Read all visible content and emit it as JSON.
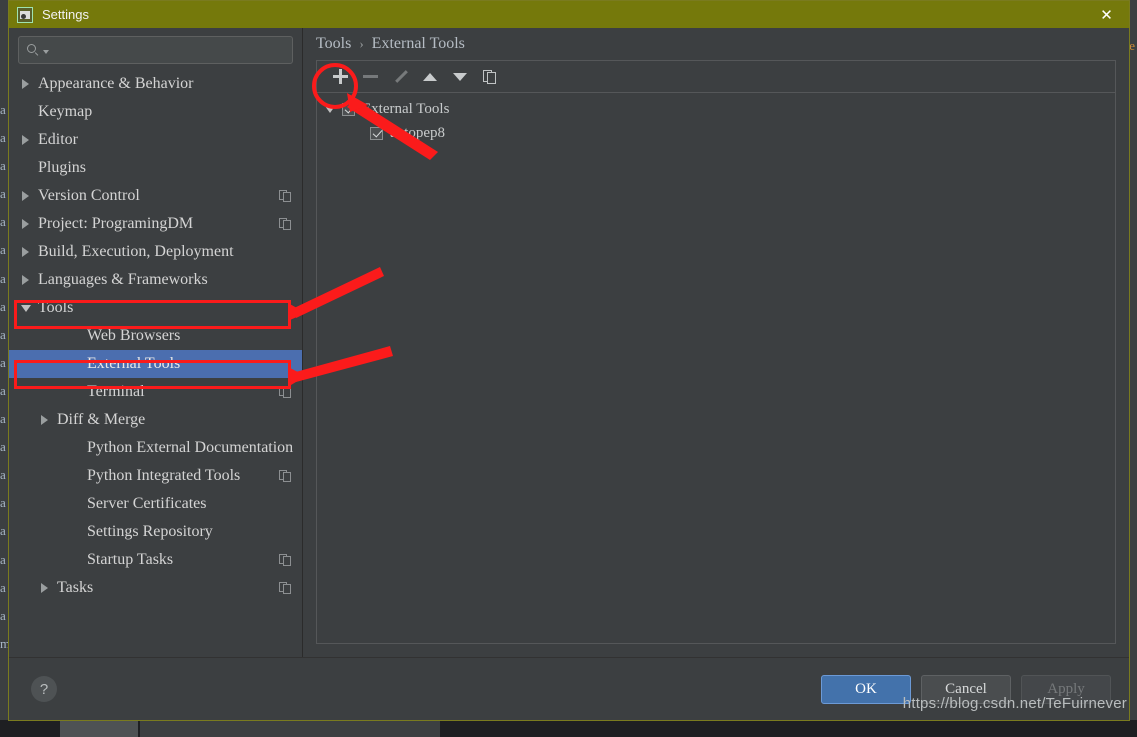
{
  "window": {
    "title": "Settings",
    "app_icon": "settings-image-icon",
    "close_icon": "close-icon"
  },
  "search": {
    "value": "",
    "placeholder": "",
    "icon": "search-icon",
    "caret_icon": "chevron-down-icon"
  },
  "sidebar": {
    "items": [
      {
        "label": "Appearance & Behavior",
        "arrow": "right",
        "level": 1,
        "badge": false,
        "selected": false
      },
      {
        "label": "Keymap",
        "arrow": "none",
        "level": 1,
        "badge": false,
        "selected": false
      },
      {
        "label": "Editor",
        "arrow": "right",
        "level": 1,
        "badge": false,
        "selected": false
      },
      {
        "label": "Plugins",
        "arrow": "none",
        "level": 1,
        "badge": false,
        "selected": false
      },
      {
        "label": "Version Control",
        "arrow": "right",
        "level": 1,
        "badge": true,
        "selected": false
      },
      {
        "label": "Project: ProgramingDM",
        "arrow": "right",
        "level": 1,
        "badge": true,
        "selected": false
      },
      {
        "label": "Build, Execution, Deployment",
        "arrow": "right",
        "level": 1,
        "badge": false,
        "selected": false
      },
      {
        "label": "Languages & Frameworks",
        "arrow": "right",
        "level": 1,
        "badge": false,
        "selected": false
      },
      {
        "label": "Tools",
        "arrow": "down",
        "level": 1,
        "badge": false,
        "selected": false
      },
      {
        "label": "Web Browsers",
        "arrow": "none",
        "level": 2,
        "badge": false,
        "selected": false
      },
      {
        "label": "External Tools",
        "arrow": "none",
        "level": 2,
        "badge": false,
        "selected": true
      },
      {
        "label": "Terminal",
        "arrow": "none",
        "level": 2,
        "badge": true,
        "selected": false
      },
      {
        "label": "Diff & Merge",
        "arrow": "right",
        "level": 2,
        "badge": false,
        "selected": false
      },
      {
        "label": "Python External Documentation",
        "arrow": "none",
        "level": 2,
        "badge": false,
        "selected": false
      },
      {
        "label": "Python Integrated Tools",
        "arrow": "none",
        "level": 2,
        "badge": true,
        "selected": false
      },
      {
        "label": "Server Certificates",
        "arrow": "none",
        "level": 2,
        "badge": false,
        "selected": false
      },
      {
        "label": "Settings Repository",
        "arrow": "none",
        "level": 2,
        "badge": false,
        "selected": false
      },
      {
        "label": "Startup Tasks",
        "arrow": "none",
        "level": 2,
        "badge": true,
        "selected": false
      },
      {
        "label": "Tasks",
        "arrow": "right",
        "level": 2,
        "badge": true,
        "selected": false
      }
    ]
  },
  "content": {
    "breadcrumb": {
      "parent": "Tools",
      "separator": "›",
      "current": "External Tools"
    },
    "toolbar": [
      {
        "name": "add-button",
        "icon": "plus-icon",
        "enabled": true
      },
      {
        "name": "remove-button",
        "icon": "minus-icon",
        "enabled": false
      },
      {
        "name": "edit-button",
        "icon": "pencil-icon",
        "enabled": false
      },
      {
        "name": "move-up-button",
        "icon": "arrow-up-icon",
        "enabled": true
      },
      {
        "name": "move-down-button",
        "icon": "arrow-down-icon",
        "enabled": true
      },
      {
        "name": "copy-button",
        "icon": "copy-icon",
        "enabled": true
      }
    ],
    "tree": [
      {
        "label": "External Tools",
        "checked": true,
        "expanded": true,
        "indent": 0
      },
      {
        "label": "autopep8",
        "checked": true,
        "expanded": null,
        "indent": 1
      }
    ]
  },
  "footer": {
    "help_icon": "question-mark-icon",
    "buttons": [
      {
        "label": "OK",
        "style": "primary"
      },
      {
        "label": "Cancel",
        "style": "normal"
      },
      {
        "label": "Apply",
        "style": "disabled"
      }
    ],
    "watermark": "https://blog.csdn.net/TeFuirnever"
  },
  "background": {
    "left_gutter_text": "a\na\na\na\na\na\na\na\na\na\na\na\na\na\na\na\na\na\na\nm",
    "right_edge_text": "e"
  },
  "colors": {
    "titlebar": "#75790b",
    "panel": "#3c3f41",
    "selection_blue": "#4b6eaf",
    "primary_button": "#4372ab",
    "annotation_red": "#fb1b1b",
    "text": "#d4d4d4"
  }
}
